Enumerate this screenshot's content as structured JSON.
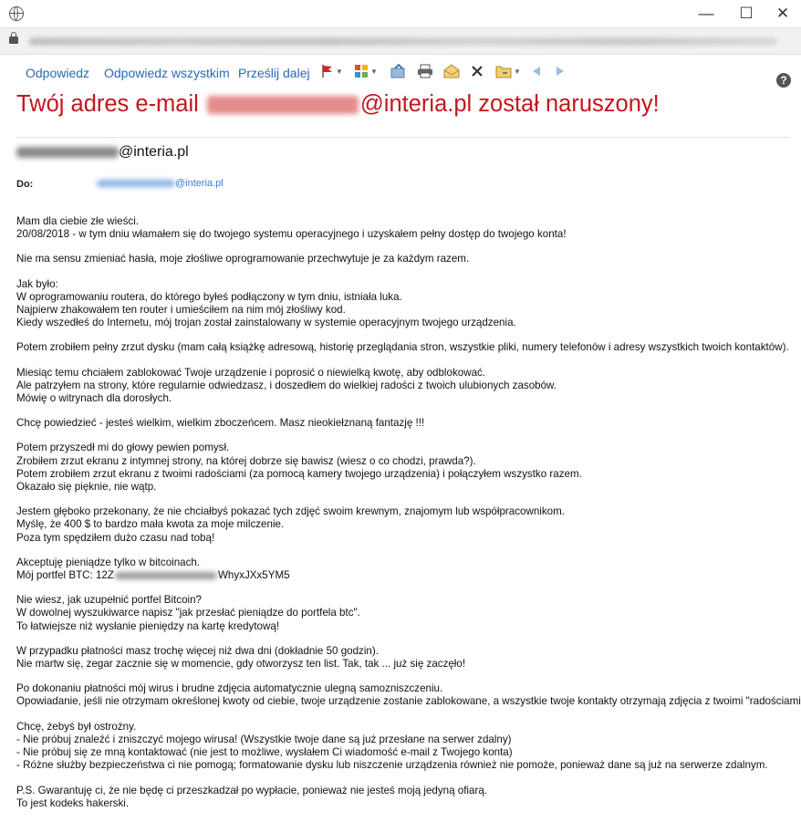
{
  "window": {
    "minimize": "—",
    "maximize": "☐",
    "close": "✕"
  },
  "toolbar": {
    "reply": "Odpowiedz",
    "reply_all": "Odpowiedz wszystkim",
    "forward": "Prześlij dalej",
    "icons": [
      "flag-icon",
      "categories-icon",
      "move-icon",
      "print-icon",
      "open-mail-icon",
      "delete-icon",
      "move-to-folder-icon",
      "previous-icon",
      "next-icon",
      "help-icon"
    ],
    "help": "?"
  },
  "email": {
    "subject_before": "Twój adres e-mail",
    "subject_after": "@interia.pl został naruszony!",
    "sender_after": "@interia.pl",
    "to_label": "Do:",
    "to_after": "@interia.pl",
    "colors": {
      "subject": "#c4161c",
      "link": "#2a6ab5"
    },
    "paragraphs": [
      {
        "lines": [
          "Mam dla ciebie złe wieści.",
          "20/08/2018 - w tym dniu włamałem się do twojego systemu operacyjnego i uzyskałem pełny dostęp do twojego konta!"
        ]
      },
      {
        "lines": [
          "Nie ma sensu zmieniać hasła, moje złośliwe oprogramowanie przechwytuje je za każdym razem."
        ]
      },
      {
        "lines": [
          "Jak było:",
          "W oprogramowaniu routera, do którego byłeś podłączony w tym dniu, istniała luka.",
          "Najpierw zhakowałem ten router i umieściłem na nim mój złośliwy kod.",
          "Kiedy wszedłeś do Internetu, mój trojan został zainstalowany w systemie operacyjnym twojego urządzenia."
        ]
      },
      {
        "lines": [
          "Potem zrobiłem pełny zrzut dysku (mam całą książkę adresową, historię przeglądania stron, wszystkie pliki, numery telefonów i adresy wszystkich twoich kontaktów)."
        ]
      },
      {
        "lines": [
          "Miesiąc temu chciałem zablokować Twoje urządzenie i poprosić o niewielką kwotę, aby odblokować.",
          "Ale patrzyłem na strony, które regularnie odwiedzasz, i doszedłem do wielkiej radości z twoich ulubionych zasobów.",
          "Mówię o witrynach dla dorosłych."
        ]
      },
      {
        "lines": [
          "Chcę powiedzieć - jesteś wielkim, wielkim zboczeńcem. Masz nieokiełznaną fantazję !!!"
        ]
      },
      {
        "lines": [
          "Potem przyszedł mi do głowy pewien pomysł.",
          "Zrobiłem zrzut ekranu z intymnej strony, na której dobrze się bawisz (wiesz o co chodzi, prawda?).",
          "Potem zrobiłem zrzut ekranu z twoimi radościami (za pomocą kamery twojego urządzenia) i połączyłem wszystko razem.",
          "Okazało się pięknie, nie wątp."
        ]
      },
      {
        "lines": [
          "Jestem głęboko przekonany, że nie chciałbyś pokazać tych zdjęć swoim krewnym, znajomym lub współpracownikom.",
          "Myślę, że 400 $ to bardzo mała kwota za moje milczenie.",
          "Poza tym spędziłem dużo czasu nad tobą!"
        ]
      },
      {
        "lines": [
          "Akceptuję pieniądze tylko w bitcoinach.",
          "Mój portfel BTC: 12Z"
        ],
        "btc_after": "WhyxJXx5YM5"
      },
      {
        "lines": [
          "Nie wiesz, jak uzupełnić portfel Bitcoin?",
          "W dowolnej wyszukiwarce napisz \"jak przesłać pieniądze do portfela btc\".",
          "To łatwiejsze niż wysłanie pieniędzy na kartę kredytową!"
        ]
      },
      {
        "lines": [
          "W przypadku płatności masz trochę więcej niż dwa dni (dokładnie 50 godzin).",
          "Nie martw się, zegar zacznie się w momencie, gdy otworzysz ten list. Tak, tak ... już się zaczęło!"
        ]
      },
      {
        "lines": [
          "Po dokonaniu płatności mój wirus i brudne zdjęcia automatycznie ulegną samozniszczeniu.",
          "Opowiadanie, jeśli nie otrzymam określonej kwoty od ciebie, twoje urządzenie zostanie zablokowane, a wszystkie twoje kontakty otrzymają zdjęcia z twoimi \"radościami\"."
        ]
      },
      {
        "lines": [
          "Chcę, żebyś był ostrożny.",
          "- Nie próbuj znaleźć i zniszczyć mojego wirusa! (Wszystkie twoje dane są już przesłane na serwer zdalny)",
          "- Nie próbuj się ze mną kontaktować (nie jest to możliwe, wysłałem Ci wiadomość e-mail z Twojego konta)",
          "- Różne służby bezpieczeństwa ci nie pomogą; formatowanie dysku lub niszczenie urządzenia również nie pomoże, ponieważ dane są już na serwerze zdalnym."
        ]
      },
      {
        "lines": [
          "P.S. Gwarantuję ci, że nie będę ci przeszkadzał po wypłacie, ponieważ nie jesteś moją jedyną ofiarą.",
          " To jest kodeks hakerski."
        ]
      }
    ]
  }
}
